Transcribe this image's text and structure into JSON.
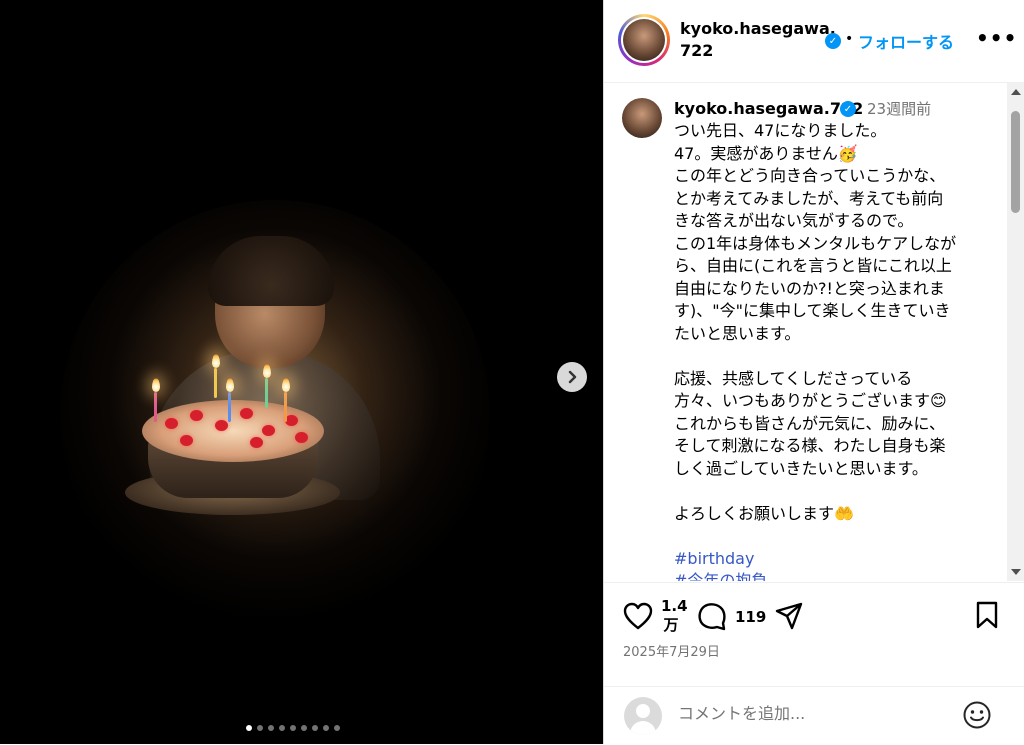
{
  "post": {
    "username_line1": "kyoko.hasegawa.",
    "username_line2": "722",
    "follow_separator": "•",
    "follow_label": "フォローする",
    "more_label": "•••",
    "verified_mark": "✓",
    "carousel": {
      "dot_count": 9,
      "active_index": 0,
      "next_label": "›"
    }
  },
  "caption": {
    "username": "kyoko.hasegawa.722",
    "time_ago": "23週間前",
    "text": "つい先日、47になりました。\n47。実感がありません🥳\nこの年とどう向き合っていこうかな、\nとか考えてみましたが、考えても前向\nきな答えが出ない気がするので。\nこの1年は身体もメンタルもケアしなが\nら、自由に(これを言うと皆にこれ以上\n自由になりたいのか?!と突っ込まれま\nす)、\"今\"に集中して楽しく生きていき\nたいと思います。\n\n応援、共感してくしださっている\n方々、いつもありがとうございます😊\nこれからも皆さんが元気に、励みに、\nそして刺激になる様、わたし自身も楽\nしく過ごしていきたいと思います。\n\nよろしくお願いします🤲",
    "hashtag1": "#birthday",
    "hashtag2": "#今年の抱負"
  },
  "actions": {
    "likes_line1": "1.4",
    "likes_line2": "万",
    "comments": "119",
    "date": "2025年7月29日"
  },
  "comment_box": {
    "placeholder": "コメントを追加..."
  },
  "colors": {
    "accent": "#0095f6",
    "hashtag": "#3858c7",
    "secondary_text": "#737373"
  }
}
